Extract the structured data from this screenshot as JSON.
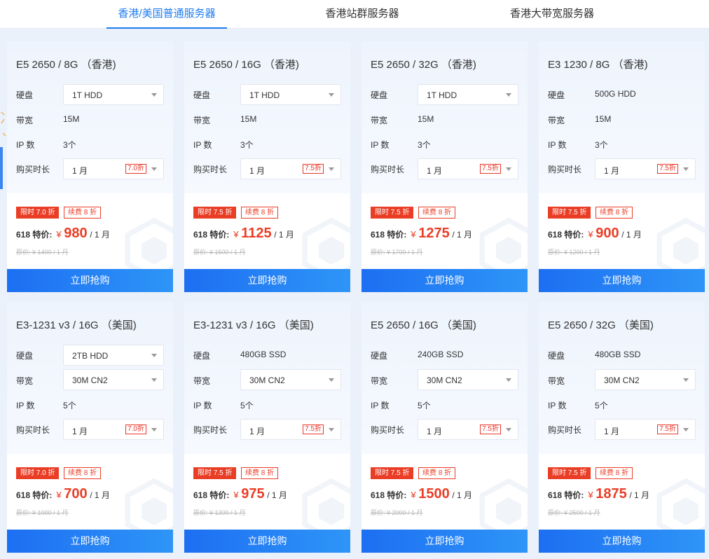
{
  "tabs": [
    {
      "label": "香港/美国普通服务器",
      "active": true
    },
    {
      "label": "香港站群服务器",
      "active": false
    },
    {
      "label": "香港大带宽服务器",
      "active": false
    }
  ],
  "labels": {
    "disk": "硬盘",
    "bandwidth": "带宽",
    "ip": "IP 数",
    "duration": "购买时长",
    "price_prefix": "618 特价:",
    "currency": "¥",
    "buy": "立即抢购"
  },
  "colors": {
    "accent": "#1f7cf0",
    "sale": "#ea3d25"
  },
  "cards": [
    {
      "title": "E5 2650 / 8G （香港)",
      "disk": "1T HDD",
      "disk_select": true,
      "bandwidth": "15M",
      "bw_select": false,
      "ip": "3个",
      "duration": "1 月",
      "discount": "7.0折",
      "limit": "限时 7.0 折",
      "renew": "续费 8 折",
      "price": "980",
      "unit": "/ 1 月",
      "original": "原价: ¥ 1400 / 1 月"
    },
    {
      "title": "E5 2650 / 16G （香港)",
      "disk": "1T HDD",
      "disk_select": true,
      "bandwidth": "15M",
      "bw_select": false,
      "ip": "3个",
      "duration": "1 月",
      "discount": "7.5折",
      "limit": "限时 7.5 折",
      "renew": "续费 8 折",
      "price": "1125",
      "unit": "/ 1 月",
      "original": "原价: ¥ 1500 / 1 月"
    },
    {
      "title": "E5 2650 / 32G （香港)",
      "disk": "1T HDD",
      "disk_select": true,
      "bandwidth": "15M",
      "bw_select": false,
      "ip": "3个",
      "duration": "1 月",
      "discount": "7.5折",
      "limit": "限时 7.5 折",
      "renew": "续费 8 折",
      "price": "1275",
      "unit": "/ 1 月",
      "original": "原价: ¥ 1700 / 1 月"
    },
    {
      "title": "E3 1230 / 8G （香港)",
      "disk": "500G HDD",
      "disk_select": false,
      "bandwidth": "15M",
      "bw_select": false,
      "ip": "3个",
      "duration": "1 月",
      "discount": "7.5折",
      "limit": "限时 7.5 折",
      "renew": "续费 8 折",
      "price": "900",
      "unit": "/ 1 月",
      "original": "原价: ¥ 1200 / 1 月"
    },
    {
      "title": "E3-1231 v3 / 16G （美国)",
      "disk": "2TB HDD",
      "disk_select": true,
      "bandwidth": "30M CN2",
      "bw_select": true,
      "ip": "5个",
      "duration": "1 月",
      "discount": "7.0折",
      "limit": "限时 7.0 折",
      "renew": "续费 8 折",
      "price": "700",
      "unit": "/ 1 月",
      "original": "原价: ¥ 1000 / 1 月"
    },
    {
      "title": "E3-1231 v3 / 16G （美国)",
      "disk": "480GB SSD",
      "disk_select": false,
      "bandwidth": "30M CN2",
      "bw_select": true,
      "ip": "5个",
      "duration": "1 月",
      "discount": "7.5折",
      "limit": "限时 7.5 折",
      "renew": "续费 8 折",
      "price": "975",
      "unit": "/ 1 月",
      "original": "原价: ¥ 1300 / 1 月"
    },
    {
      "title": "E5 2650 / 16G （美国)",
      "disk": "240GB SSD",
      "disk_select": false,
      "bandwidth": "30M CN2",
      "bw_select": true,
      "ip": "5个",
      "duration": "1 月",
      "discount": "7.5折",
      "limit": "限时 7.5 折",
      "renew": "续费 8 折",
      "price": "1500",
      "unit": "/ 1 月",
      "original": "原价: ¥ 2000 / 1 月"
    },
    {
      "title": "E5 2650 / 32G （美国)",
      "disk": "480GB SSD",
      "disk_select": false,
      "bandwidth": "30M CN2",
      "bw_select": true,
      "ip": "5个",
      "duration": "1 月",
      "discount": "7.5折",
      "limit": "限时 7.5 折",
      "renew": "续费 8 折",
      "price": "1875",
      "unit": "/ 1 月",
      "original": "原价: ¥ 2500 / 1 月"
    }
  ]
}
